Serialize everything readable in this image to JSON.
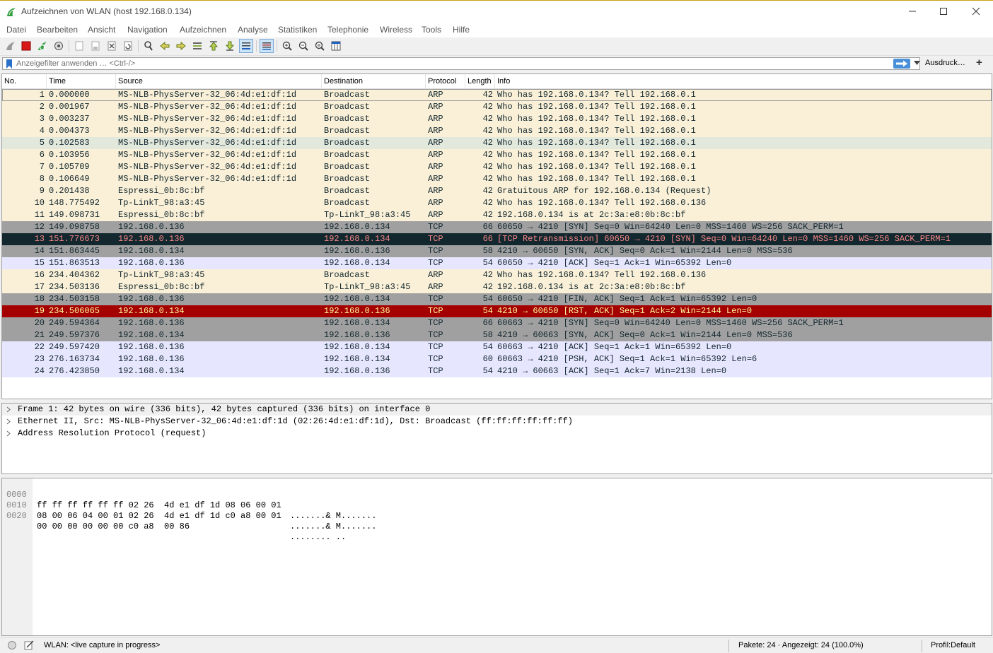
{
  "window": {
    "title": "Aufzeichnen von WLAN (host 192.168.0.134)"
  },
  "menu": [
    "Datei",
    "Bearbeiten",
    "Ansicht",
    "Navigation",
    "Aufzeichnen",
    "Analyse",
    "Statistiken",
    "Telephonie",
    "Wireless",
    "Tools",
    "Hilfe"
  ],
  "filter": {
    "placeholder": "Anzeigefilter anwenden … <Ctrl-/>",
    "value": "",
    "expression_label": "Ausdruck…",
    "add_label": "+"
  },
  "columns": [
    "No.",
    "Time",
    "Source",
    "Destination",
    "Protocol",
    "Length",
    "Info"
  ],
  "packets": [
    {
      "no": "1",
      "time": "0.000000",
      "src": "MS-NLB-PhysServer-32_06:4d:e1:df:1d",
      "dst": "Broadcast",
      "proto": "ARP",
      "len": "42",
      "info": "Who has 192.168.0.134? Tell 192.168.0.1"
    },
    {
      "no": "2",
      "time": "0.001967",
      "src": "MS-NLB-PhysServer-32_06:4d:e1:df:1d",
      "dst": "Broadcast",
      "proto": "ARP",
      "len": "42",
      "info": "Who has 192.168.0.134? Tell 192.168.0.1"
    },
    {
      "no": "3",
      "time": "0.003237",
      "src": "MS-NLB-PhysServer-32_06:4d:e1:df:1d",
      "dst": "Broadcast",
      "proto": "ARP",
      "len": "42",
      "info": "Who has 192.168.0.134? Tell 192.168.0.1"
    },
    {
      "no": "4",
      "time": "0.004373",
      "src": "MS-NLB-PhysServer-32_06:4d:e1:df:1d",
      "dst": "Broadcast",
      "proto": "ARP",
      "len": "42",
      "info": "Who has 192.168.0.134? Tell 192.168.0.1"
    },
    {
      "no": "5",
      "time": "0.102583",
      "src": "MS-NLB-PhysServer-32_06:4d:e1:df:1d",
      "dst": "Broadcast",
      "proto": "ARP",
      "len": "42",
      "info": "Who has 192.168.0.134? Tell 192.168.0.1"
    },
    {
      "no": "6",
      "time": "0.103956",
      "src": "MS-NLB-PhysServer-32_06:4d:e1:df:1d",
      "dst": "Broadcast",
      "proto": "ARP",
      "len": "42",
      "info": "Who has 192.168.0.134? Tell 192.168.0.1"
    },
    {
      "no": "7",
      "time": "0.105709",
      "src": "MS-NLB-PhysServer-32_06:4d:e1:df:1d",
      "dst": "Broadcast",
      "proto": "ARP",
      "len": "42",
      "info": "Who has 192.168.0.134? Tell 192.168.0.1"
    },
    {
      "no": "8",
      "time": "0.106649",
      "src": "MS-NLB-PhysServer-32_06:4d:e1:df:1d",
      "dst": "Broadcast",
      "proto": "ARP",
      "len": "42",
      "info": "Who has 192.168.0.134? Tell 192.168.0.1"
    },
    {
      "no": "9",
      "time": "0.201438",
      "src": "Espressi_0b:8c:bf",
      "dst": "Broadcast",
      "proto": "ARP",
      "len": "42",
      "info": "Gratuitous ARP for 192.168.0.134 (Request)"
    },
    {
      "no": "10",
      "time": "148.775492",
      "src": "Tp-LinkT_98:a3:45",
      "dst": "Broadcast",
      "proto": "ARP",
      "len": "42",
      "info": "Who has 192.168.0.134? Tell 192.168.0.136"
    },
    {
      "no": "11",
      "time": "149.098731",
      "src": "Espressi_0b:8c:bf",
      "dst": "Tp-LinkT_98:a3:45",
      "proto": "ARP",
      "len": "42",
      "info": "192.168.0.134 is at 2c:3a:e8:0b:8c:bf"
    },
    {
      "no": "12",
      "time": "149.098758",
      "src": "192.168.0.136",
      "dst": "192.168.0.134",
      "proto": "TCP",
      "len": "66",
      "info": "60650 → 4210 [SYN] Seq=0 Win=64240 Len=0 MSS=1460 WS=256 SACK_PERM=1"
    },
    {
      "no": "13",
      "time": "151.776673",
      "src": "192.168.0.136",
      "dst": "192.168.0.134",
      "proto": "TCP",
      "len": "66",
      "info": "[TCP Retransmission] 60650 → 4210 [SYN] Seq=0 Win=64240 Len=0 MSS=1460 WS=256 SACK_PERM=1"
    },
    {
      "no": "14",
      "time": "151.863445",
      "src": "192.168.0.134",
      "dst": "192.168.0.136",
      "proto": "TCP",
      "len": "58",
      "info": "4210 → 60650 [SYN, ACK] Seq=0 Ack=1 Win=2144 Len=0 MSS=536"
    },
    {
      "no": "15",
      "time": "151.863513",
      "src": "192.168.0.136",
      "dst": "192.168.0.134",
      "proto": "TCP",
      "len": "54",
      "info": "60650 → 4210 [ACK] Seq=1 Ack=1 Win=65392 Len=0"
    },
    {
      "no": "16",
      "time": "234.404362",
      "src": "Tp-LinkT_98:a3:45",
      "dst": "Broadcast",
      "proto": "ARP",
      "len": "42",
      "info": "Who has 192.168.0.134? Tell 192.168.0.136"
    },
    {
      "no": "17",
      "time": "234.503136",
      "src": "Espressi_0b:8c:bf",
      "dst": "Tp-LinkT_98:a3:45",
      "proto": "ARP",
      "len": "42",
      "info": "192.168.0.134 is at 2c:3a:e8:0b:8c:bf"
    },
    {
      "no": "18",
      "time": "234.503158",
      "src": "192.168.0.136",
      "dst": "192.168.0.134",
      "proto": "TCP",
      "len": "54",
      "info": "60650 → 4210 [FIN, ACK] Seq=1 Ack=1 Win=65392 Len=0"
    },
    {
      "no": "19",
      "time": "234.506065",
      "src": "192.168.0.134",
      "dst": "192.168.0.136",
      "proto": "TCP",
      "len": "54",
      "info": "4210 → 60650 [RST, ACK] Seq=1 Ack=2 Win=2144 Len=0"
    },
    {
      "no": "20",
      "time": "249.594364",
      "src": "192.168.0.136",
      "dst": "192.168.0.134",
      "proto": "TCP",
      "len": "66",
      "info": "60663 → 4210 [SYN] Seq=0 Win=64240 Len=0 MSS=1460 WS=256 SACK_PERM=1"
    },
    {
      "no": "21",
      "time": "249.597376",
      "src": "192.168.0.134",
      "dst": "192.168.0.136",
      "proto": "TCP",
      "len": "58",
      "info": "4210 → 60663 [SYN, ACK] Seq=0 Ack=1 Win=2144 Len=0 MSS=536"
    },
    {
      "no": "22",
      "time": "249.597420",
      "src": "192.168.0.136",
      "dst": "192.168.0.134",
      "proto": "TCP",
      "len": "54",
      "info": "60663 → 4210 [ACK] Seq=1 Ack=1 Win=65392 Len=0"
    },
    {
      "no": "23",
      "time": "276.163734",
      "src": "192.168.0.136",
      "dst": "192.168.0.134",
      "proto": "TCP",
      "len": "60",
      "info": "60663 → 4210 [PSH, ACK] Seq=1 Ack=1 Win=65392 Len=6"
    },
    {
      "no": "24",
      "time": "276.423850",
      "src": "192.168.0.134",
      "dst": "192.168.0.136",
      "proto": "TCP",
      "len": "54",
      "info": "4210 → 60663 [ACK] Seq=1 Ack=7 Win=2138 Len=0"
    }
  ],
  "row_colors": {
    "arp": {
      "bg": "#faf0d7",
      "fg": "#12272e"
    },
    "arp_highlight": {
      "bg": "#e3e8dd",
      "fg": "#12272e"
    },
    "tcp_syn_fin": {
      "bg": "#a0a0a0",
      "fg": "#12272e"
    },
    "tcp": {
      "bg": "#e7e6ff",
      "fg": "#12272e"
    },
    "bad_tcp": {
      "bg": "#12272e",
      "fg": "#f78787"
    },
    "tcp_rst": {
      "bg": "#a40000",
      "fg": "#fffc9c"
    }
  },
  "row_styles": [
    "arp",
    "arp",
    "arp",
    "arp",
    "arp_highlight",
    "arp",
    "arp",
    "arp",
    "arp",
    "arp",
    "arp",
    "tcp_syn_fin",
    "bad_tcp",
    "tcp_syn_fin",
    "tcp",
    "arp",
    "arp",
    "tcp_syn_fin",
    "tcp_rst",
    "tcp_syn_fin",
    "tcp_syn_fin",
    "tcp",
    "tcp",
    "tcp"
  ],
  "selected_row": 0,
  "details": [
    "Frame 1: 42 bytes on wire (336 bits), 42 bytes captured (336 bits) on interface 0",
    "Ethernet II, Src: MS-NLB-PhysServer-32_06:4d:e1:df:1d (02:26:4d:e1:df:1d), Dst: Broadcast (ff:ff:ff:ff:ff:ff)",
    "Address Resolution Protocol (request)"
  ],
  "hex": [
    {
      "offset": "0000",
      "bytes": "ff ff ff ff ff ff 02 26  4d e1 df 1d 08 06 00 01",
      "ascii": ".......& M......."
    },
    {
      "offset": "0010",
      "bytes": "08 00 06 04 00 01 02 26  4d e1 df 1d c0 a8 00 01",
      "ascii": ".......& M......."
    },
    {
      "offset": "0020",
      "bytes": "00 00 00 00 00 00 c0 a8  00 86",
      "ascii": "........ .."
    }
  ],
  "status": {
    "capture": "WLAN: <live capture in progress>",
    "packets": "Pakete: 24 · Angezeigt: 24 (100.0%)",
    "profile": "Profil:Default"
  },
  "toolbar_icons": [
    "shark-fin-start-icon",
    "stop-icon",
    "restart-icon",
    "capture-options-icon",
    "open-file-icon",
    "save-file-icon",
    "close-file-icon",
    "reload-file-icon",
    "find-packet-icon",
    "go-back-icon",
    "go-forward-icon",
    "go-to-packet-icon",
    "first-packet-icon",
    "last-packet-icon",
    "autoscroll-icon",
    "colorize-icon",
    "zoom-in-icon",
    "zoom-out-icon",
    "normal-size-icon",
    "resize-columns-icon"
  ]
}
